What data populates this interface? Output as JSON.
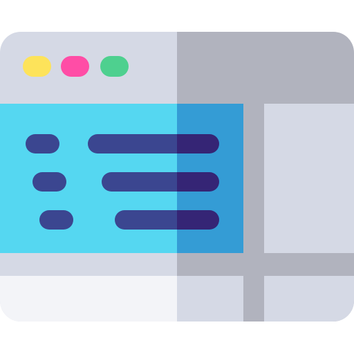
{
  "icon": {
    "semantic_name": "browser-window-code-icon",
    "colors": {
      "frame_light": "#D5D9E5",
      "frame_shaded": "#B1B3BE",
      "footer_light": "#F3F4F8",
      "footer_shaded": "#D5D9E5",
      "side_panel": "#D5D9E5",
      "content_light": "#55D7F1",
      "content_shaded": "#349CD5",
      "code_line_light": "#3B4690",
      "code_line_shaded": "#352575",
      "dot_yellow": "#FDE35A",
      "dot_pink": "#FF4DA6",
      "dot_green": "#4ED08F"
    },
    "window_controls": [
      {
        "name": "window-dot-yellow-icon",
        "color_key": "dot_yellow"
      },
      {
        "name": "window-dot-pink-icon",
        "color_key": "dot_pink"
      },
      {
        "name": "window-dot-green-icon",
        "color_key": "dot_green"
      }
    ],
    "code_rows": 3
  }
}
